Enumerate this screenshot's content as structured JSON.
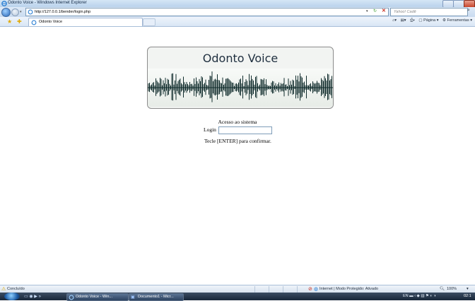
{
  "window": {
    "title": "Odonto Voice - Windows Internet Explorer"
  },
  "nav": {
    "url": "http://127.0.0.1/bender/login.php",
    "search_placeholder": "Yahoo! Cadê"
  },
  "tabs": [
    {
      "label": "Odonto Voice"
    }
  ],
  "commands": {
    "page_label": "Página",
    "tools_label": "Ferramentas"
  },
  "content": {
    "banner_title": "Odonto Voice",
    "access_title": "Acesso ao sistema",
    "login_label": "Login",
    "login_value": "",
    "hint": "Tecle [ENTER] para confirmar."
  },
  "status": {
    "text": "Concluído",
    "zone": "Internet | Modo Protegido: Ativado",
    "zoom": "100%"
  },
  "taskbar": {
    "items": [
      {
        "label": "Odonto Voice - Win..."
      },
      {
        "label": "Documento1 - Micr..."
      }
    ],
    "language": "EN",
    "clock": "02:1"
  },
  "colors": {
    "accent": "#2a67b8",
    "wave": "#0f2b2b"
  }
}
